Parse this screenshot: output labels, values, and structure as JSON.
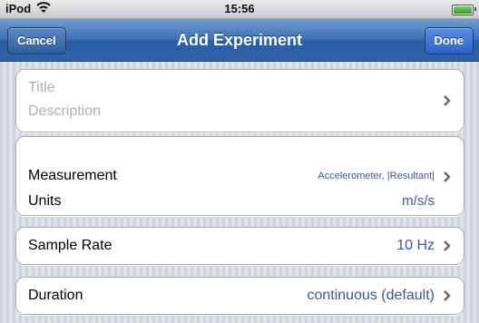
{
  "status_bar": {
    "carrier": "iPod",
    "time": "15:56"
  },
  "nav": {
    "cancel_label": "Cancel",
    "title": "Add Experiment",
    "done_label": "Done"
  },
  "title_group": {
    "title_placeholder": "Title",
    "description_placeholder": "Description"
  },
  "measurement_group": {
    "measurement_label": "Measurement",
    "measurement_value": "Accelerometer, |Resultant|",
    "units_label": "Units",
    "units_value": "m/s/s"
  },
  "sample_rate": {
    "label": "Sample Rate",
    "value": "10 Hz"
  },
  "duration": {
    "label": "Duration",
    "value": "continuous (default)"
  },
  "icons": [
    "wifi-icon",
    "battery-icon",
    "chevron-right-icon"
  ],
  "colors": {
    "nav_blue": "#2f62a6",
    "value_blue": "#3d5a8e",
    "background": "#d5d8de"
  }
}
